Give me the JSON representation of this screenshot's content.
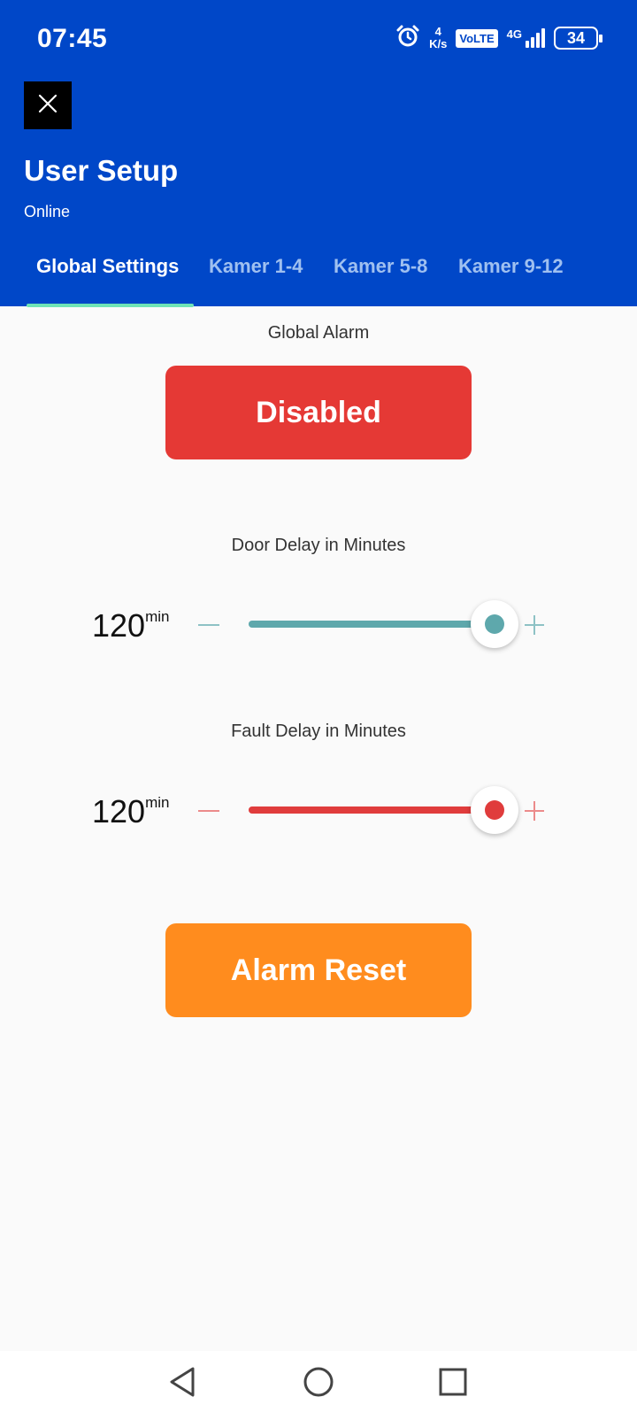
{
  "status_bar": {
    "time": "07:45",
    "speed_value": "4",
    "speed_unit": "K/s",
    "volte": "VoLTE",
    "network": "4G",
    "battery": "34"
  },
  "header": {
    "title": "User Setup",
    "subtitle": "Online"
  },
  "tabs": [
    {
      "label": "Global Settings",
      "active": true
    },
    {
      "label": "Kamer 1-4",
      "active": false
    },
    {
      "label": "Kamer 5-8",
      "active": false
    },
    {
      "label": "Kamer 9-12",
      "active": false
    }
  ],
  "global_alarm": {
    "label": "Global Alarm",
    "button_label": "Disabled",
    "button_color": "#e53935"
  },
  "door_delay": {
    "label": "Door Delay in Minutes",
    "value": "120",
    "unit": "min",
    "level": 1.0,
    "color": "#5ea8ac"
  },
  "fault_delay": {
    "label": "Fault Delay in Minutes",
    "value": "120",
    "unit": "min",
    "level": 1.0,
    "color": "#e03c3c"
  },
  "alarm_reset": {
    "button_label": "Alarm Reset",
    "button_color": "#ff8c1e"
  },
  "icons": {
    "close": "close-icon",
    "alarm": "alarm-clock-icon",
    "back": "back-triangle-icon",
    "home": "home-circle-icon",
    "recents": "recents-square-icon"
  }
}
